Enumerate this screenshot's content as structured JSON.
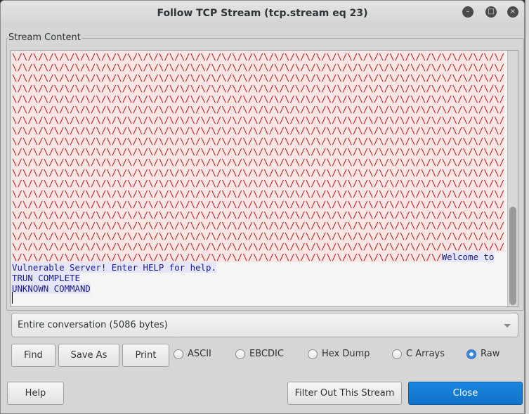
{
  "window": {
    "title": "Follow TCP Stream (tcp.stream eq 23)"
  },
  "stream": {
    "label": "Stream Content",
    "client_line": "\\/\\/\\/\\/\\/\\/\\/\\/\\/\\/\\/\\/\\/\\/\\/\\/\\/\\/\\/\\/\\/\\/\\/\\/\\/\\/\\/\\/\\/\\/\\/\\/\\/\\/\\/\\/\\/\\/\\/\\/\\/\\/\\/\\/\\/\\/\\/",
    "client_line_count": 19,
    "client_last": "\\/\\/\\/\\/\\/\\/\\/\\/\\/\\/\\/\\/\\/\\/\\/\\/\\/\\/\\/\\/\\/\\/\\/\\/\\/\\/\\/\\/\\/\\/\\/\\/\\/\\/\\/\\/\\/\\/\\/\\/\\/",
    "server_lines": [
      "Welcome to",
      "Vulnerable Server! Enter HELP for help.",
      "TRUN COMPLETE",
      "UNKNOWN COMMAND"
    ]
  },
  "conversation_select": {
    "value": "Entire conversation (5086 bytes)"
  },
  "buttons": {
    "find": "Find",
    "save_as": "Save As",
    "print": "Print",
    "help": "Help",
    "filter_out": "Filter Out This Stream",
    "close": "Close"
  },
  "formats": {
    "options": [
      "ASCII",
      "EBCDIC",
      "Hex Dump",
      "C Arrays",
      "Raw"
    ],
    "selected": "Raw"
  },
  "colors": {
    "client": "#b22222",
    "server": "#1a1a8c",
    "accent": "#1a86df"
  }
}
